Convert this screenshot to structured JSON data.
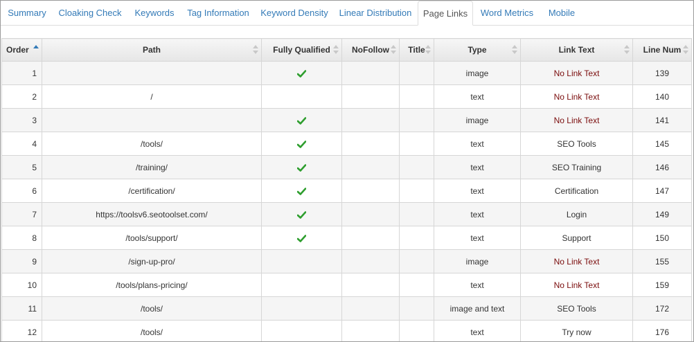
{
  "tabs": [
    {
      "label": "Summary"
    },
    {
      "label": "Cloaking Check"
    },
    {
      "label": "Keywords"
    },
    {
      "label": "Tag Information"
    },
    {
      "label": "Keyword Density"
    },
    {
      "label": "Linear Distribution"
    },
    {
      "label": "Page Links",
      "active": true
    },
    {
      "label": "Word Metrics"
    },
    {
      "label": "Mobile"
    }
  ],
  "columns": [
    "Order",
    "Path",
    "Fully Qualified",
    "NoFollow",
    "Title",
    "Type",
    "Link Text",
    "Line Num"
  ],
  "sort": {
    "column": "Order",
    "direction": "asc"
  },
  "colors": {
    "accent": "#337ab7",
    "check": "#2e9e2e",
    "no_link_text": "#7a0c0c"
  },
  "rows": [
    {
      "order": "1",
      "path": "",
      "fully_qualified": true,
      "nofollow": "",
      "title": "",
      "type": "image",
      "link_text": "No Link Text",
      "line_num": "139"
    },
    {
      "order": "2",
      "path": "/",
      "fully_qualified": false,
      "nofollow": "",
      "title": "",
      "type": "text",
      "link_text": "No Link Text",
      "line_num": "140"
    },
    {
      "order": "3",
      "path": "",
      "fully_qualified": true,
      "nofollow": "",
      "title": "",
      "type": "image",
      "link_text": "No Link Text",
      "line_num": "141"
    },
    {
      "order": "4",
      "path": "/tools/",
      "fully_qualified": true,
      "nofollow": "",
      "title": "",
      "type": "text",
      "link_text": "SEO Tools",
      "line_num": "145"
    },
    {
      "order": "5",
      "path": "/training/",
      "fully_qualified": true,
      "nofollow": "",
      "title": "",
      "type": "text",
      "link_text": "SEO Training",
      "line_num": "146"
    },
    {
      "order": "6",
      "path": "/certification/",
      "fully_qualified": true,
      "nofollow": "",
      "title": "",
      "type": "text",
      "link_text": "Certification",
      "line_num": "147"
    },
    {
      "order": "7",
      "path": "https://toolsv6.seotoolset.com/",
      "fully_qualified": true,
      "nofollow": "",
      "title": "",
      "type": "text",
      "link_text": "Login",
      "line_num": "149"
    },
    {
      "order": "8",
      "path": "/tools/support/",
      "fully_qualified": true,
      "nofollow": "",
      "title": "",
      "type": "text",
      "link_text": "Support",
      "line_num": "150"
    },
    {
      "order": "9",
      "path": "/sign-up-pro/",
      "fully_qualified": false,
      "nofollow": "",
      "title": "",
      "type": "image",
      "link_text": "No Link Text",
      "line_num": "155"
    },
    {
      "order": "10",
      "path": "/tools/plans-pricing/",
      "fully_qualified": false,
      "nofollow": "",
      "title": "",
      "type": "text",
      "link_text": "No Link Text",
      "line_num": "159"
    },
    {
      "order": "11",
      "path": "/tools/",
      "fully_qualified": false,
      "nofollow": "",
      "title": "",
      "type": "image and text",
      "link_text": "SEO Tools",
      "line_num": "172"
    },
    {
      "order": "12",
      "path": "/tools/",
      "fully_qualified": false,
      "nofollow": "",
      "title": "",
      "type": "text",
      "link_text": "Try now",
      "line_num": "176"
    }
  ]
}
